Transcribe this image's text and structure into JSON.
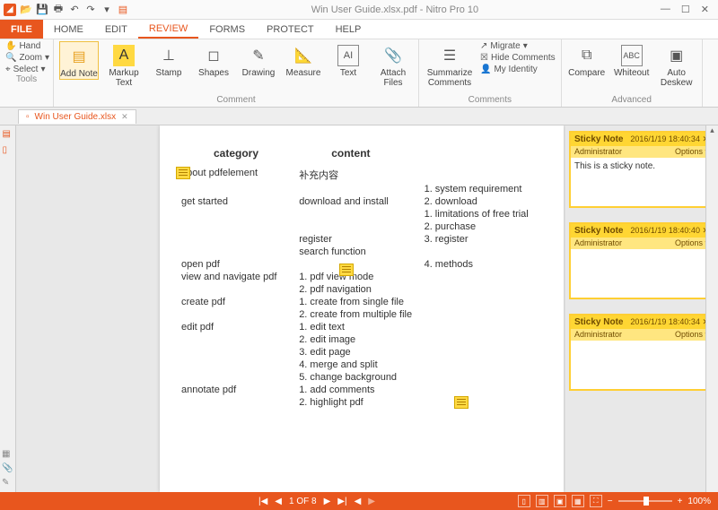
{
  "titlebar": {
    "title": "Win User Guide.xlsx.pdf - Nitro Pro 10"
  },
  "menu": {
    "file": "FILE",
    "home": "HOME",
    "edit": "EDIT",
    "review": "REVIEW",
    "forms": "FORMS",
    "protect": "PROTECT",
    "help": "HELP"
  },
  "ribbon": {
    "tools": {
      "hand": "Hand",
      "zoom": "Zoom",
      "select": "Select",
      "label": "Tools"
    },
    "comment": {
      "addnote": "Add Note",
      "markup": "Markup Text",
      "stamp": "Stamp",
      "shapes": "Shapes",
      "drawing": "Drawing",
      "measure": "Measure",
      "text": "Text",
      "attach": "Attach Files",
      "label": "Comment"
    },
    "comments": {
      "summarize": "Summarize Comments",
      "migrate": "Migrate",
      "hide": "Hide Comments",
      "identity": "My Identity",
      "label": "Comments"
    },
    "advanced": {
      "compare": "Compare",
      "whiteout": "Whiteout",
      "deskew": "Auto Deskew",
      "label": "Advanced"
    }
  },
  "doctab": {
    "name": "Win User Guide.xlsx"
  },
  "page": {
    "h_cat": "category",
    "h_con": "content",
    "rows": [
      {
        "a": "about pdfelement",
        "b": "补充内容",
        "c": ""
      },
      {
        "a": "",
        "b": "",
        "c": "1. system requirement"
      },
      {
        "a": "get started",
        "b": "download and install",
        "c": "2. download"
      },
      {
        "a": "",
        "b": "",
        "c": "1. limitations of free trial"
      },
      {
        "a": "",
        "b": "",
        "c": "2. purchase"
      },
      {
        "a": "",
        "b": "register",
        "c": "3. register"
      },
      {
        "a": "",
        "b": "search function",
        "c": ""
      },
      {
        "a": "open pdf",
        "b": "",
        "c": "4. methods"
      },
      {
        "a": "view and navigate pdf",
        "b": "1. pdf view mode",
        "c": ""
      },
      {
        "a": "",
        "b": "2. pdf navigation",
        "c": ""
      },
      {
        "a": "create pdf",
        "b": "1. create from single file",
        "c": ""
      },
      {
        "a": "",
        "b": "2. create from multiple file",
        "c": ""
      },
      {
        "a": "edit pdf",
        "b": "1. edit text",
        "c": ""
      },
      {
        "a": "",
        "b": "2. edit image",
        "c": ""
      },
      {
        "a": "",
        "b": "3. edit page",
        "c": ""
      },
      {
        "a": "",
        "b": "4. merge and split",
        "c": ""
      },
      {
        "a": "",
        "b": "5. change background",
        "c": ""
      },
      {
        "a": "annotate pdf",
        "b": "1. add comments",
        "c": ""
      },
      {
        "a": "",
        "b": "2. highlight pdf",
        "c": ""
      }
    ]
  },
  "notes": [
    {
      "title": "Sticky Note",
      "date": "2016/1/19 18:40:34",
      "author": "Administrator",
      "options": "Options",
      "body": "This is a sticky note."
    },
    {
      "title": "Sticky Note",
      "date": "2016/1/19 18:40:40",
      "author": "Administrator",
      "options": "Options",
      "body": ""
    },
    {
      "title": "Sticky Note",
      "date": "2016/1/19 18:40:34",
      "author": "Administrator",
      "options": "Options",
      "body": ""
    }
  ],
  "status": {
    "page": "1 OF 8",
    "zoom": "100%"
  }
}
